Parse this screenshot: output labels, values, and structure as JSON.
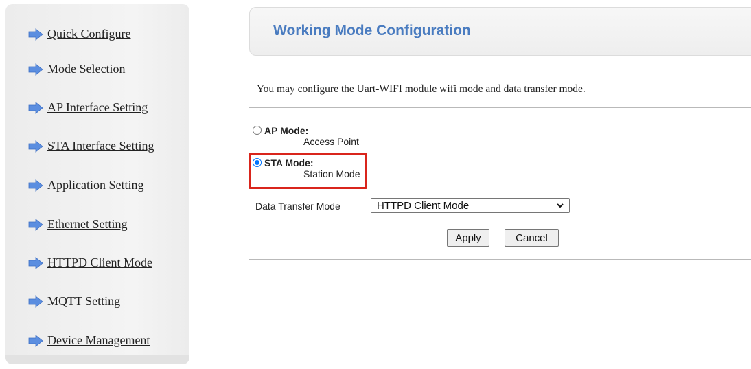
{
  "sidebar": {
    "items": [
      {
        "label": "Quick Configure"
      },
      {
        "label": "Mode Selection"
      },
      {
        "label": "AP Interface Setting"
      },
      {
        "label": "STA Interface Setting"
      },
      {
        "label": "Application Setting"
      },
      {
        "label": "Ethernet Setting"
      },
      {
        "label": "HTTPD Client Mode"
      },
      {
        "label": "MQTT Setting"
      },
      {
        "label": "Device Management"
      }
    ],
    "icon": "arrow-right-icon",
    "icon_color": "#5b8ee0"
  },
  "header": {
    "title": "Working Mode Configuration",
    "title_color": "#4a7cc0"
  },
  "main": {
    "description": "You may configure the Uart-WIFI module wifi mode and data transfer mode.",
    "modes": [
      {
        "title": "AP Mode:",
        "subtitle": "Access Point",
        "selected": false
      },
      {
        "title": "STA Mode:",
        "subtitle": "Station Mode",
        "selected": true
      }
    ],
    "highlight_color": "#d9251c",
    "data_transfer": {
      "label": "Data Transfer Mode",
      "value": "HTTPD Client Mode"
    },
    "buttons": {
      "apply": "Apply",
      "cancel": "Cancel"
    }
  }
}
